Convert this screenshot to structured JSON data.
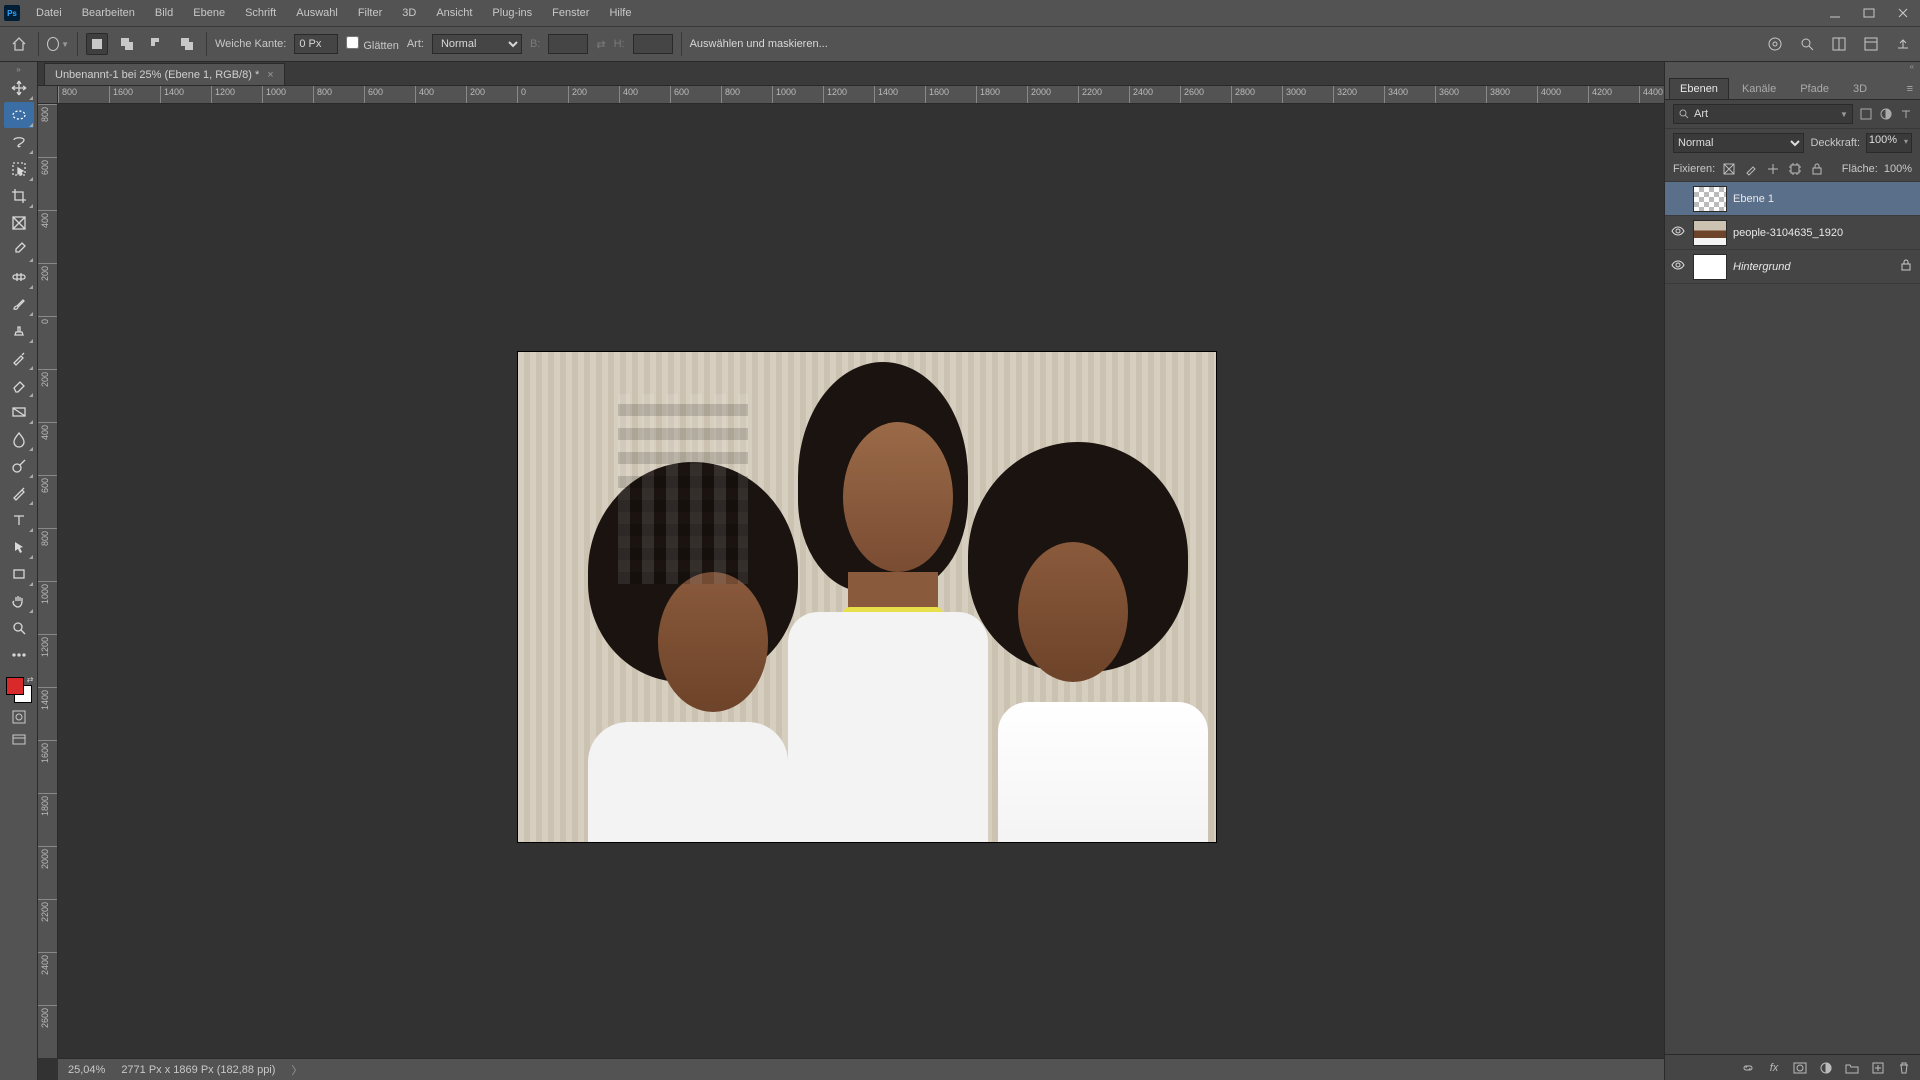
{
  "menubar": {
    "items": [
      "Datei",
      "Bearbeiten",
      "Bild",
      "Ebene",
      "Schrift",
      "Auswahl",
      "Filter",
      "3D",
      "Ansicht",
      "Plug-ins",
      "Fenster",
      "Hilfe"
    ]
  },
  "optbar": {
    "feather_label": "Weiche Kante:",
    "feather_value": "0 Px",
    "antialias_label": "Glätten",
    "style_label": "Art:",
    "style_value": "Normal",
    "width_label": "B:",
    "height_label": "H:",
    "mask_button": "Auswählen und maskieren..."
  },
  "document": {
    "tab_title": "Unbenannt-1 bei 25% (Ebene 1, RGB/8) *"
  },
  "ruler_h": [
    "800",
    "1600",
    "1400",
    "1200",
    "1000",
    "800",
    "600",
    "400",
    "200",
    "0",
    "200",
    "400",
    "600",
    "800",
    "1000",
    "1200",
    "1400",
    "1600",
    "1800",
    "2000",
    "2200",
    "2400",
    "2600",
    "2800",
    "3000",
    "3200",
    "3400",
    "3600",
    "3800",
    "4000",
    "4200",
    "4400"
  ],
  "ruler_v": [
    "800",
    "600",
    "400",
    "200",
    "0",
    "200",
    "400",
    "600",
    "800",
    "1000",
    "1200",
    "1400",
    "1600",
    "1800",
    "2000",
    "2200",
    "2400",
    "2600"
  ],
  "statusbar": {
    "zoom": "25,04%",
    "info": "2771 Px x 1869 Px (182,88 ppi)"
  },
  "panels": {
    "tabs": [
      "Ebenen",
      "Kanäle",
      "Pfade",
      "3D"
    ],
    "search_value": "Art",
    "blend_mode": "Normal",
    "opacity_label": "Deckkraft:",
    "opacity_value": "100%",
    "lock_label": "Fixieren:",
    "fill_label": "Fläche:",
    "fill_value": "100%",
    "layers": [
      {
        "name": "Ebene 1",
        "thumb": "checker",
        "visible": false,
        "selected": true,
        "italic": false,
        "locked": false
      },
      {
        "name": "people-3104635_1920",
        "thumb": "photo",
        "visible": true,
        "selected": false,
        "italic": false,
        "locked": false
      },
      {
        "name": "Hintergrund",
        "thumb": "white",
        "visible": true,
        "selected": false,
        "italic": true,
        "locked": true
      }
    ]
  },
  "colors": {
    "accent": "#31a8ff",
    "foreground_swatch": "#d82a2a",
    "background_swatch": "#ffffff"
  }
}
